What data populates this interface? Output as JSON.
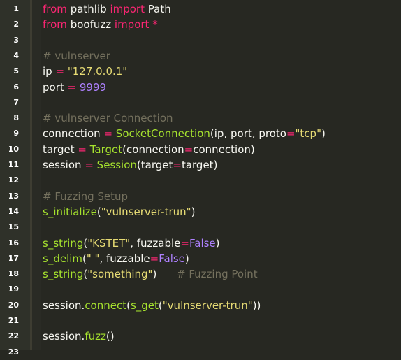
{
  "editor": {
    "lines": [
      {
        "n": "1",
        "text": "from pathlib import Path"
      },
      {
        "n": "2",
        "text": "from boofuzz import *"
      },
      {
        "n": "3",
        "text": ""
      },
      {
        "n": "4",
        "text": "# vulnserver"
      },
      {
        "n": "5",
        "text": "ip = \"127.0.0.1\""
      },
      {
        "n": "6",
        "text": "port = 9999"
      },
      {
        "n": "7",
        "text": ""
      },
      {
        "n": "8",
        "text": "# vulnserver Connection"
      },
      {
        "n": "9",
        "text": "connection = SocketConnection(ip, port, proto=\"tcp\")"
      },
      {
        "n": "10",
        "text": "target = Target(connection=connection)"
      },
      {
        "n": "11",
        "text": "session = Session(target=target)"
      },
      {
        "n": "12",
        "text": ""
      },
      {
        "n": "13",
        "text": "# Fuzzing Setup"
      },
      {
        "n": "14",
        "text": "s_initialize(\"vulnserver-trun\")"
      },
      {
        "n": "15",
        "text": ""
      },
      {
        "n": "16",
        "text": "s_string(\"KSTET\", fuzzable=False)"
      },
      {
        "n": "17",
        "text": "s_delim(\" \", fuzzable=False)"
      },
      {
        "n": "18",
        "text": "s_string(\"something\")      # Fuzzing Point"
      },
      {
        "n": "19",
        "text": ""
      },
      {
        "n": "20",
        "text": "session.connect(s_get(\"vulnserver-trun\"))"
      },
      {
        "n": "21",
        "text": ""
      },
      {
        "n": "22",
        "text": "session.fuzz()"
      },
      {
        "n": "23",
        "text": ""
      }
    ]
  },
  "colors": {
    "background": "#272822",
    "gutter": "#2f3129",
    "text": "#f8f8f2",
    "keyword": "#f92672",
    "string": "#e6db74",
    "number": "#ae81ff",
    "comment": "#75715e",
    "function": "#a6e22e"
  }
}
